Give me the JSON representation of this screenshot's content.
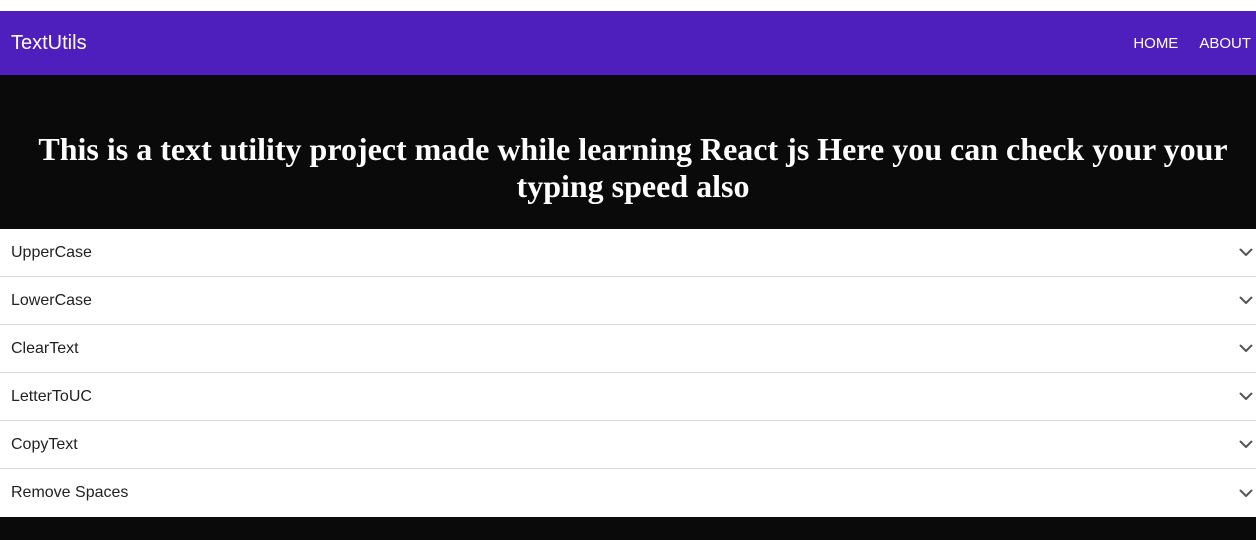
{
  "navbar": {
    "brand": "TextUtils",
    "links": [
      {
        "label": "HOME"
      },
      {
        "label": "ABOUT"
      }
    ],
    "background": "#4f1fbd"
  },
  "hero": {
    "title": "This is a text utility project made while learning React js Here you can check your your typing speed also"
  },
  "accordion": {
    "items": [
      {
        "label": "UpperCase",
        "icon": "chevron-down-icon"
      },
      {
        "label": "LowerCase",
        "icon": "chevron-down-icon"
      },
      {
        "label": "ClearText",
        "icon": "chevron-down-icon"
      },
      {
        "label": "LetterToUC",
        "icon": "chevron-down-icon"
      },
      {
        "label": "CopyText",
        "icon": "chevron-down-icon"
      },
      {
        "label": "Remove Spaces",
        "icon": "chevron-down-icon"
      }
    ]
  }
}
